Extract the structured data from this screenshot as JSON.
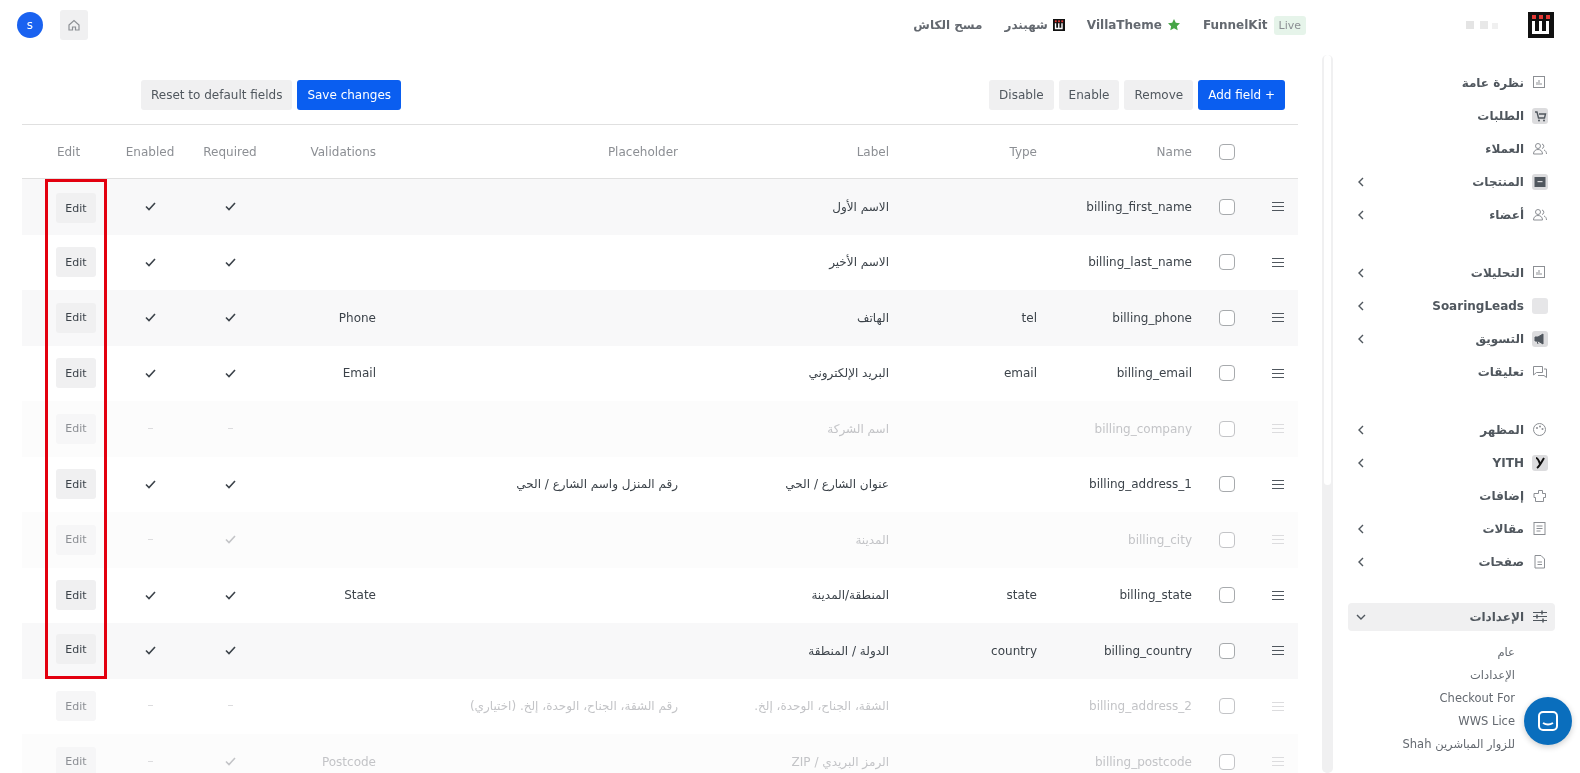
{
  "topbar": {
    "avatar": "s",
    "badge": "Live",
    "links": [
      "FunnelKit",
      "VillaTheme",
      "شهبندر",
      "مسح الكاش"
    ]
  },
  "toolbar": {
    "right_buttons": [
      "Add field +",
      "Remove",
      "Enable",
      "Disable"
    ],
    "left_buttons": [
      "Save changes",
      "Reset to default fields"
    ]
  },
  "table": {
    "select_all_checked": false,
    "columns": [
      "Name",
      "Type",
      "Label",
      "Placeholder",
      "Validations",
      "Required",
      "Enabled",
      "Edit"
    ],
    "rows": [
      {
        "edit": "Edit",
        "enabled": true,
        "required": true,
        "label": "الاسم الأول",
        "name": "billing_first_name",
        "checked": false,
        "highlighted": true
      },
      {
        "edit": "Edit",
        "enabled": true,
        "required": true,
        "label": "الاسم الأخير",
        "name": "billing_last_name",
        "checked": false,
        "highlighted": true
      },
      {
        "edit": "Edit",
        "enabled": true,
        "required": true,
        "validation": "Phone",
        "label": "الهاتف",
        "type": "tel",
        "name": "billing_phone",
        "checked": false,
        "highlighted": true
      },
      {
        "edit": "Edit",
        "enabled": true,
        "required": true,
        "validation": "Email",
        "label": "البريد الإلكتروني",
        "type": "email",
        "name": "billing_email",
        "checked": false,
        "highlighted": true
      },
      {
        "edit": "Edit",
        "enabled": false,
        "required": false,
        "label": "اسم الشركة",
        "name": "billing_company",
        "checked": false,
        "highlighted": true
      },
      {
        "edit": "Edit",
        "enabled": true,
        "required": true,
        "placeholder": "رقم المنزل واسم الشارع / الحي",
        "label": "عنوان الشارع / الحي",
        "name": "billing_address_1",
        "checked": false,
        "highlighted": true
      },
      {
        "edit": "Edit",
        "enabled": false,
        "required": true,
        "label": "المدينة",
        "name": "billing_city",
        "checked": false,
        "highlighted": true
      },
      {
        "edit": "Edit",
        "enabled": true,
        "required": true,
        "validation": "State",
        "label": "المنطقة/المدينة",
        "type": "state",
        "name": "billing_state",
        "checked": false,
        "highlighted": true
      },
      {
        "edit": "Edit",
        "enabled": true,
        "required": true,
        "label": "الدولة / المنطقة",
        "type": "country",
        "name": "billing_country",
        "checked": false,
        "highlighted": true
      },
      {
        "edit": "Edit",
        "enabled": false,
        "required": false,
        "placeholder": "رقم الشقة، الجناح، الوحدة، إلخ. (اختياري)",
        "label": "الشقة، الجناح، الوحدة، إلخ.",
        "name": "billing_address_2",
        "checked": false,
        "highlighted": false
      },
      {
        "edit": "Edit",
        "enabled": false,
        "required": true,
        "validation": "Postcode",
        "label": "الرمز البريدي / ZIP",
        "name": "billing_postcode",
        "checked": false,
        "highlighted": false
      }
    ]
  },
  "sidebar": {
    "groups": [
      [
        {
          "label": "نظرة عامة",
          "selected": false
        },
        {
          "label": "الطلبات",
          "selected": false
        },
        {
          "label": "العملاء",
          "selected": false
        },
        {
          "label": "المنتجات",
          "expanded": false,
          "selected": false
        },
        {
          "label": "أعضاء",
          "expanded": false,
          "selected": false
        }
      ],
      [
        {
          "label": "التحليلات",
          "expanded": false,
          "selected": false
        },
        {
          "label": "SoaringLeads",
          "expanded": false,
          "selected": false
        },
        {
          "label": "التسويق",
          "expanded": false,
          "selected": false
        },
        {
          "label": "تعليقات",
          "selected": false
        }
      ],
      [
        {
          "label": "المظهر",
          "expanded": false,
          "selected": false
        },
        {
          "label": "YITH",
          "expanded": false,
          "selected": false
        },
        {
          "label": "إضافات",
          "selected": false
        },
        {
          "label": "مقالات",
          "expanded": false,
          "selected": false
        },
        {
          "label": "صفحات",
          "expanded": false,
          "selected": false
        }
      ],
      [
        {
          "label": "الإعدادات",
          "expanded": true,
          "selected": true,
          "children": [
            "عام",
            "الإعدادات",
            "Checkout For",
            "WWS Lice",
            "Shah للزوار المباشرين"
          ]
        }
      ]
    ]
  }
}
